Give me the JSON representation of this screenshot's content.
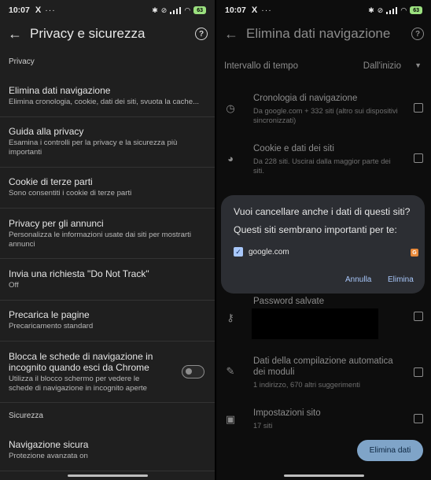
{
  "status": {
    "time": "10:07",
    "x_icon": "X",
    "dots": "···",
    "battery": "63"
  },
  "left": {
    "title": "Privacy e sicurezza",
    "section_privacy": "Privacy",
    "items": [
      {
        "title": "Elimina dati navigazione",
        "subtitle": "Elimina cronologia, cookie, dati dei siti, svuota la cache..."
      },
      {
        "title": "Guida alla privacy",
        "subtitle": "Esamina i controlli per la privacy e la sicurezza più importanti"
      },
      {
        "title": "Cookie di terze parti",
        "subtitle": "Sono consentiti i cookie di terze parti"
      },
      {
        "title": "Privacy per gli annunci",
        "subtitle": "Personalizza le informazioni usate dai siti per mostrarti annunci"
      },
      {
        "title": "Invia una richiesta \"Do Not Track\"",
        "subtitle": "Off"
      },
      {
        "title": "Precarica le pagine",
        "subtitle": "Precaricamento standard"
      },
      {
        "title": "Blocca le schede di navigazione in incognito quando esci da Chrome",
        "subtitle": "Utilizza il blocco schermo per vedere le schede di navigazione in incognito aperte",
        "toggle": false
      }
    ],
    "section_security": "Sicurezza",
    "safe_browsing": {
      "title": "Navigazione sicura",
      "subtitle": "Protezione avanzata on"
    }
  },
  "right": {
    "title": "Elimina dati navigazione",
    "range_label": "Intervallo di tempo",
    "range_value": "Dall'inizio",
    "rows": [
      {
        "icon": "clock-icon",
        "title": "Cronologia di navigazione",
        "subtitle": "Da google.com + 332 siti (altro sui dispositivi sincronizzati)"
      },
      {
        "icon": "cookie-icon",
        "title": "Cookie e dati dei siti",
        "subtitle": "Da 228 siti. Uscirai dalla maggior parte dei siti."
      },
      {
        "icon": "key-icon",
        "title": "Password salvate",
        "subtitle": ""
      },
      {
        "icon": "pencil-icon",
        "title": "Dati della compilazione automatica dei moduli",
        "subtitle": "1 indirizzo, 670 altri suggerimenti"
      },
      {
        "icon": "site-settings-icon",
        "title": "Impostazioni sito",
        "subtitle": "17 siti"
      }
    ],
    "dialog": {
      "heading": "Vuoi cancellare anche i dati di questi siti?",
      "subheading": "Questi siti sembrano importanti per te:",
      "site": "google.com",
      "site_badge": "G",
      "cancel": "Annulla",
      "confirm": "Elimina"
    },
    "primary_button": "Elimina dati"
  }
}
